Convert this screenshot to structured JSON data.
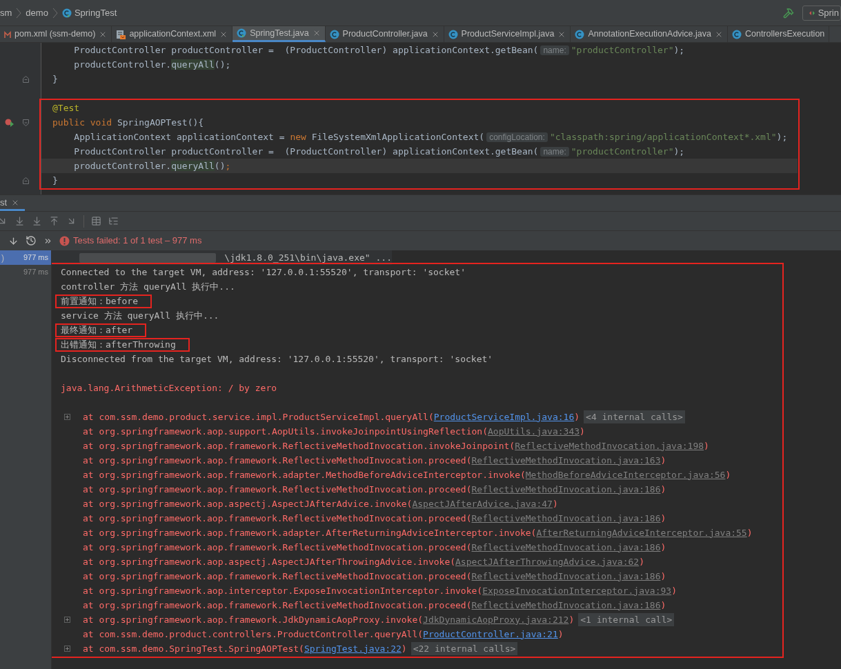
{
  "breadcrumbs": [
    {
      "label": "sm"
    },
    {
      "label": "demo"
    },
    {
      "label": "SpringTest",
      "kind": "test-class"
    }
  ],
  "run_config": {
    "label": "Sprin"
  },
  "editor_tabs": [
    {
      "label": "pom.xml (ssm-demo)",
      "kind": "maven",
      "selected": false,
      "closable": true
    },
    {
      "label": "applicationContext.xml",
      "kind": "xml",
      "selected": false,
      "closable": true
    },
    {
      "label": "SpringTest.java",
      "kind": "test-class",
      "selected": true,
      "closable": true
    },
    {
      "label": "ProductController.java",
      "kind": "class",
      "selected": false,
      "closable": true
    },
    {
      "label": "ProductServiceImpl.java",
      "kind": "class",
      "selected": false,
      "closable": true
    },
    {
      "label": "AnnotationExecutionAdvice.java",
      "kind": "class",
      "selected": false,
      "closable": true
    },
    {
      "label": "ControllersExecution",
      "kind": "class",
      "selected": false,
      "closable": false
    }
  ],
  "editor": {
    "lines": [
      {
        "kind": "code",
        "framed": false,
        "current": false,
        "tokens": [
          {
            "kind": "plain",
            "t": "    ProductController productController =  (ProductController) applicationContext.getBean("
          },
          {
            "kind": "hint",
            "t": "name:"
          },
          {
            "kind": "string",
            "t": "\"productController\""
          },
          {
            "kind": "plain",
            "t": ");"
          }
        ]
      },
      {
        "kind": "code",
        "framed": false,
        "current": false,
        "tokens": [
          {
            "kind": "plain",
            "t": "    productController."
          },
          {
            "kind": "usage",
            "t": "queryAll"
          },
          {
            "kind": "plain",
            "t": "();"
          }
        ]
      },
      {
        "kind": "code",
        "framed": false,
        "current": false,
        "gutter": [
          {
            "kind": "fold-end"
          }
        ],
        "tokens": [
          {
            "kind": "plain",
            "t": "}"
          }
        ]
      },
      {
        "kind": "blank"
      },
      {
        "kind": "code",
        "framed": true,
        "current": false,
        "tokens": [
          {
            "kind": "annotation",
            "t": "@Test"
          }
        ]
      },
      {
        "kind": "code",
        "framed": true,
        "current": false,
        "gutter": [
          {
            "kind": "run-failed"
          },
          {
            "kind": "fold-start"
          }
        ],
        "tokens": [
          {
            "kind": "keyword",
            "t": "public void "
          },
          {
            "kind": "plain",
            "t": "SpringAOPTest(){"
          }
        ]
      },
      {
        "kind": "code",
        "framed": true,
        "current": false,
        "tokens": [
          {
            "kind": "plain",
            "t": "    ApplicationContext applicationContext = "
          },
          {
            "kind": "keyword",
            "t": "new "
          },
          {
            "kind": "plain",
            "t": "FileSystemXmlApplicationContext("
          },
          {
            "kind": "hint",
            "t": "configLocation:"
          },
          {
            "kind": "string",
            "t": "\"classpath:spring/applicationContext*.xml\""
          },
          {
            "kind": "plain",
            "t": ");"
          }
        ]
      },
      {
        "kind": "code",
        "framed": true,
        "current": false,
        "tokens": [
          {
            "kind": "plain",
            "t": "    ProductController productController =  (ProductController) applicationContext.getBean("
          },
          {
            "kind": "hint",
            "t": "name:"
          },
          {
            "kind": "string",
            "t": "\"productController\""
          },
          {
            "kind": "plain",
            "t": ");"
          }
        ]
      },
      {
        "kind": "code",
        "framed": true,
        "current": true,
        "tokens": [
          {
            "kind": "plain",
            "t": "    productController."
          },
          {
            "kind": "usage",
            "t": "queryAll"
          },
          {
            "kind": "plain",
            "t": "()"
          },
          {
            "kind": "keyword",
            "t": ";"
          }
        ]
      },
      {
        "kind": "code",
        "framed": true,
        "current": false,
        "gutter": [
          {
            "kind": "fold-end"
          }
        ],
        "tokens": [
          {
            "kind": "plain",
            "t": "}"
          }
        ]
      }
    ]
  },
  "tool_window": {
    "tab": {
      "label": "st",
      "selected": true
    }
  },
  "test_status": {
    "failed": true,
    "text": "Tests failed: 1 of 1 test – 977 ms"
  },
  "test_tree": [
    {
      "label": ")",
      "time": "977 ms",
      "selected": true
    },
    {
      "time": "977 ms",
      "selected": false
    }
  ],
  "console": {
    "lines": [
      {
        "kind": "command",
        "framed": false,
        "text": "\\jdk1.8.0_251\\bin\\java.exe\" ..."
      },
      {
        "kind": "output",
        "framed": true,
        "boxed": false,
        "text": "Connected to the target VM, address: '127.0.0.1:55520', transport: 'socket'"
      },
      {
        "kind": "output",
        "framed": true,
        "boxed": false,
        "text": "controller 方法 queryAll 执行中..."
      },
      {
        "kind": "output",
        "framed": true,
        "boxed": true,
        "text": "前置通知：before"
      },
      {
        "kind": "output",
        "framed": true,
        "boxed": false,
        "text": "service 方法 queryAll 执行中..."
      },
      {
        "kind": "output",
        "framed": true,
        "boxed": true,
        "text": "最终通知：after"
      },
      {
        "kind": "output",
        "framed": true,
        "boxed": true,
        "text": "出错通知：afterThrowing"
      },
      {
        "kind": "output",
        "framed": true,
        "boxed": false,
        "text": "Disconnected from the target VM, address: '127.0.0.1:55520', transport: 'socket'"
      },
      {
        "kind": "blank",
        "framed": true
      },
      {
        "kind": "error",
        "framed": true,
        "text": "java.lang.ArithmeticException: / by zero"
      },
      {
        "kind": "blank",
        "framed": true
      },
      {
        "kind": "frame",
        "framed": true,
        "expandable": true,
        "text": "at com.ssm.demo.product.service.impl.ProductServiceImpl.queryAll(",
        "link": {
          "text": "ProductServiceImpl.java:16",
          "kind": "project"
        },
        "after": ")",
        "internal": "<4 internal calls>"
      },
      {
        "kind": "frame",
        "framed": true,
        "expandable": false,
        "text": "at org.springframework.aop.support.AopUtils.invokeJoinpointUsingReflection(",
        "link": {
          "text": "AopUtils.java:343",
          "kind": "library"
        },
        "after": ")"
      },
      {
        "kind": "frame",
        "framed": true,
        "expandable": false,
        "text": "at org.springframework.aop.framework.ReflectiveMethodInvocation.invokeJoinpoint(",
        "link": {
          "text": "ReflectiveMethodInvocation.java:198",
          "kind": "library"
        },
        "after": ")"
      },
      {
        "kind": "frame",
        "framed": true,
        "expandable": false,
        "text": "at org.springframework.aop.framework.ReflectiveMethodInvocation.proceed(",
        "link": {
          "text": "ReflectiveMethodInvocation.java:163",
          "kind": "library"
        },
        "after": ")"
      },
      {
        "kind": "frame",
        "framed": true,
        "expandable": false,
        "text": "at org.springframework.aop.framework.adapter.MethodBeforeAdviceInterceptor.invoke(",
        "link": {
          "text": "MethodBeforeAdviceInterceptor.java:56",
          "kind": "library"
        },
        "after": ")"
      },
      {
        "kind": "frame",
        "framed": true,
        "expandable": false,
        "text": "at org.springframework.aop.framework.ReflectiveMethodInvocation.proceed(",
        "link": {
          "text": "ReflectiveMethodInvocation.java:186",
          "kind": "library"
        },
        "after": ")"
      },
      {
        "kind": "frame",
        "framed": true,
        "expandable": false,
        "text": "at org.springframework.aop.aspectj.AspectJAfterAdvice.invoke(",
        "link": {
          "text": "AspectJAfterAdvice.java:47",
          "kind": "library"
        },
        "after": ")"
      },
      {
        "kind": "frame",
        "framed": true,
        "expandable": false,
        "text": "at org.springframework.aop.framework.ReflectiveMethodInvocation.proceed(",
        "link": {
          "text": "ReflectiveMethodInvocation.java:186",
          "kind": "library"
        },
        "after": ")"
      },
      {
        "kind": "frame",
        "framed": true,
        "expandable": false,
        "text": "at org.springframework.aop.framework.adapter.AfterReturningAdviceInterceptor.invoke(",
        "link": {
          "text": "AfterReturningAdviceInterceptor.java:55",
          "kind": "library"
        },
        "after": ")"
      },
      {
        "kind": "frame",
        "framed": true,
        "expandable": false,
        "text": "at org.springframework.aop.framework.ReflectiveMethodInvocation.proceed(",
        "link": {
          "text": "ReflectiveMethodInvocation.java:186",
          "kind": "library"
        },
        "after": ")"
      },
      {
        "kind": "frame",
        "framed": true,
        "expandable": false,
        "text": "at org.springframework.aop.aspectj.AspectJAfterThrowingAdvice.invoke(",
        "link": {
          "text": "AspectJAfterThrowingAdvice.java:62",
          "kind": "library"
        },
        "after": ")"
      },
      {
        "kind": "frame",
        "framed": true,
        "expandable": false,
        "text": "at org.springframework.aop.framework.ReflectiveMethodInvocation.proceed(",
        "link": {
          "text": "ReflectiveMethodInvocation.java:186",
          "kind": "library"
        },
        "after": ")"
      },
      {
        "kind": "frame",
        "framed": true,
        "expandable": false,
        "text": "at org.springframework.aop.interceptor.ExposeInvocationInterceptor.invoke(",
        "link": {
          "text": "ExposeInvocationInterceptor.java:93",
          "kind": "library"
        },
        "after": ")"
      },
      {
        "kind": "frame",
        "framed": true,
        "expandable": false,
        "text": "at org.springframework.aop.framework.ReflectiveMethodInvocation.proceed(",
        "link": {
          "text": "ReflectiveMethodInvocation.java:186",
          "kind": "library"
        },
        "after": ")"
      },
      {
        "kind": "frame",
        "framed": true,
        "expandable": true,
        "text": "at org.springframework.aop.framework.JdkDynamicAopProxy.invoke(",
        "link": {
          "text": "JdkDynamicAopProxy.java:212",
          "kind": "library"
        },
        "after": ")",
        "internal": "<1 internal call>"
      },
      {
        "kind": "frame",
        "framed": true,
        "expandable": false,
        "text": "at com.ssm.demo.product.controllers.ProductController.queryAll(",
        "link": {
          "text": "ProductController.java:21",
          "kind": "project"
        },
        "after": ")"
      },
      {
        "kind": "frame",
        "framed": true,
        "expandable": true,
        "text": "at com.ssm.demo.SpringTest.SpringAOPTest(",
        "link": {
          "text": "SpringTest.java:22",
          "kind": "project"
        },
        "after": ")",
        "internal": "<22 internal calls>"
      }
    ]
  }
}
